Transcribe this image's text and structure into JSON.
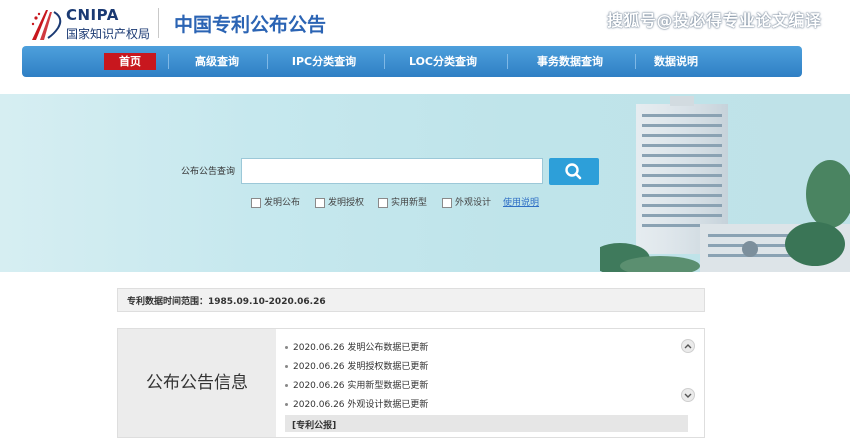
{
  "header": {
    "logo_en": "CNIPA",
    "logo_cn": "国家知识产权局",
    "site_title": "中国专利公布公告",
    "watermark": "搜狐号@投必得专业论文编译"
  },
  "nav": {
    "items": [
      {
        "label": "首页",
        "active": true
      },
      {
        "label": "高级查询"
      },
      {
        "label": "IPC分类查询"
      },
      {
        "label": "LOC分类查询"
      },
      {
        "label": "事务数据查询"
      },
      {
        "label": "数据说明"
      }
    ]
  },
  "search": {
    "label": "公布公告查询",
    "value": "",
    "placeholder": "",
    "options": [
      "发明公布",
      "发明授权",
      "实用新型",
      "外观设计"
    ],
    "usage_link": "使用说明"
  },
  "data_range": {
    "text": "专利数据时间范围：1985.09.10-2020.06.26"
  },
  "notice": {
    "title": "公布公告信息",
    "items": [
      "2020.06.26 发明公布数据已更新",
      "2020.06.26 发明授权数据已更新",
      "2020.06.26 实用新型数据已更新",
      "2020.06.26 外观设计数据已更新"
    ],
    "gazette": "[专利公报]"
  },
  "colors": {
    "brand_blue": "#2b64b4",
    "nav_blue": "#3a8ed0",
    "active_red": "#c8171e",
    "search_button": "#2d9fd9"
  }
}
